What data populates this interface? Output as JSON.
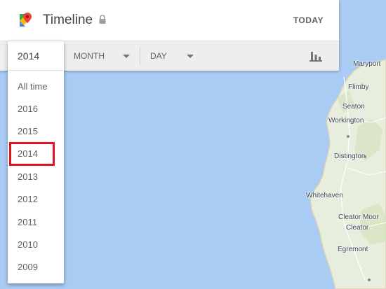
{
  "header": {
    "title": "Timeline",
    "today_label": "TODAY",
    "logo_icon": "google-maps-pin-icon",
    "lock_icon": "lock-icon"
  },
  "toolbar": {
    "month_label": "MONTH",
    "day_label": "DAY",
    "chart_icon": "bar-chart-icon"
  },
  "year_dropdown": {
    "selected": "2014",
    "options": [
      "All time",
      "2016",
      "2015",
      "2014",
      "2013",
      "2012",
      "2011",
      "2010",
      "2009"
    ],
    "highlighted": "2014"
  },
  "map": {
    "places": [
      "Maryport",
      "Flimby",
      "Seaton",
      "Workington",
      "Distington",
      "Whitehaven",
      "Cleator Moor",
      "Cleator",
      "Egremont"
    ],
    "sea_color": "#a9cbf4",
    "land_color": "#e8eedd"
  },
  "colors": {
    "highlight_border": "#e0141e"
  }
}
